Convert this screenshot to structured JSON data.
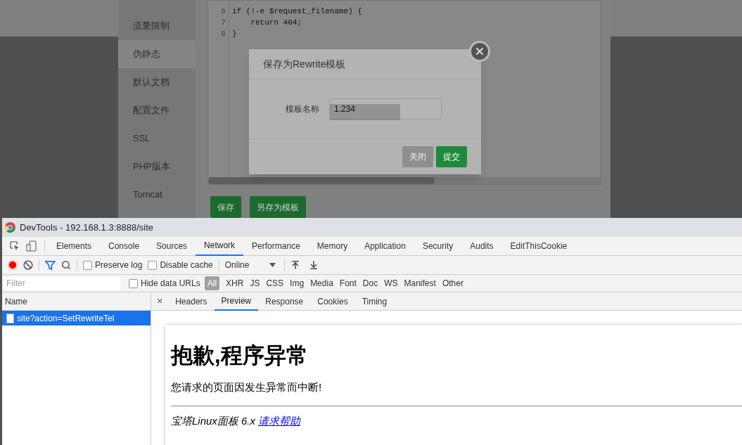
{
  "page": {
    "sidebar": [
      {
        "label": "流量限制",
        "selected": false
      },
      {
        "label": "伪静态",
        "selected": true
      },
      {
        "label": "默认文档",
        "selected": false
      },
      {
        "label": "配置文件",
        "selected": false
      },
      {
        "label": "SSL",
        "selected": false
      },
      {
        "label": "PHP版本",
        "selected": false
      },
      {
        "label": "Tomcat",
        "selected": false
      }
    ],
    "code_lines": [
      {
        "number": "6",
        "text": "if (!-e $request_filename) {"
      },
      {
        "number": "7",
        "text": "    return 404;"
      },
      {
        "number": "8",
        "text": "}"
      }
    ],
    "buttons": [
      "保存",
      "另存为模板"
    ]
  },
  "dialog": {
    "title": "保存为Rewrite模板",
    "field_label": "模板名称",
    "value": "1.234",
    "buttons": [
      {
        "label": "关闭",
        "kind": "secondary"
      },
      {
        "label": "提交",
        "kind": "primary"
      }
    ]
  },
  "devtools": {
    "title": "DevTools - 192.168.1.3:8888/site",
    "tabs": [
      {
        "label": "Elements",
        "selected": false
      },
      {
        "label": "Console",
        "selected": false
      },
      {
        "label": "Sources",
        "selected": false
      },
      {
        "label": "Network",
        "selected": true
      },
      {
        "label": "Performance",
        "selected": false
      },
      {
        "label": "Memory",
        "selected": false
      },
      {
        "label": "Application",
        "selected": false
      },
      {
        "label": "Security",
        "selected": false
      },
      {
        "label": "Audits",
        "selected": false
      },
      {
        "label": "EditThisCookie",
        "selected": false
      }
    ],
    "toolbar": {
      "recording": true,
      "preserve_log": {
        "label": "Preserve log",
        "checked": false
      },
      "disable_cache": {
        "label": "Disable cache",
        "checked": false
      },
      "throttle": "Online"
    },
    "filter": {
      "placeholder": "Filter",
      "hide_data_urls": {
        "label": "Hide data URLs",
        "checked": false
      },
      "types": [
        {
          "label": "All",
          "selected": true
        },
        {
          "label": "XHR",
          "selected": false
        },
        {
          "label": "JS",
          "selected": false
        },
        {
          "label": "CSS",
          "selected": false
        },
        {
          "label": "Img",
          "selected": false
        },
        {
          "label": "Media",
          "selected": false
        },
        {
          "label": "Font",
          "selected": false
        },
        {
          "label": "Doc",
          "selected": false
        },
        {
          "label": "WS",
          "selected": false
        },
        {
          "label": "Manifest",
          "selected": false
        },
        {
          "label": "Other",
          "selected": false
        }
      ]
    },
    "requests": {
      "header": "Name",
      "items": [
        {
          "name": "site?action=SetRewriteTel",
          "selected": true
        }
      ]
    },
    "close": "×",
    "detail_tabs": [
      {
        "label": "Headers",
        "selected": false
      },
      {
        "label": "Preview",
        "selected": true
      },
      {
        "label": "Response",
        "selected": false
      },
      {
        "label": "Cookies",
        "selected": false
      },
      {
        "label": "Timing",
        "selected": false
      }
    ],
    "preview": {
      "heading": "抱歉,程序异常",
      "message": "您请求的页面因发生异常而中断!",
      "footer": "宝塔Linux面板 6.x",
      "link": "请求帮助"
    }
  }
}
